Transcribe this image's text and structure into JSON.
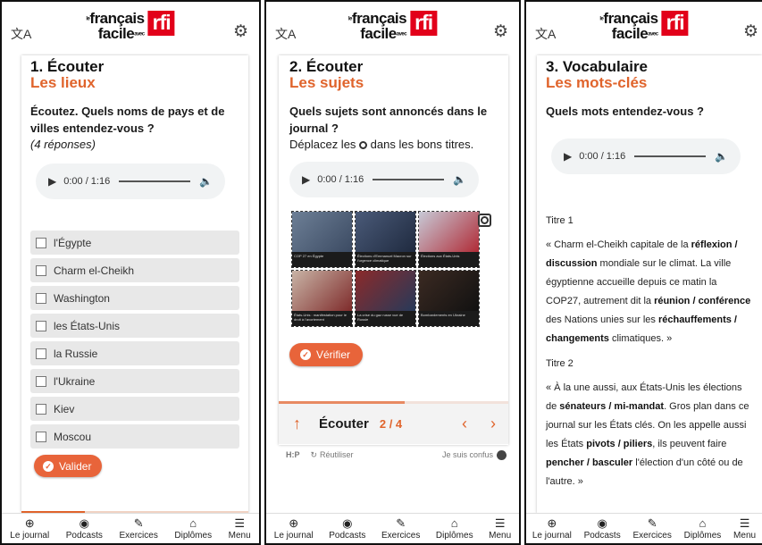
{
  "panels": [
    {
      "header": {
        "translate_icon": "translate-icon",
        "settings_icon": "gear-icon"
      },
      "section": "1. Écouter",
      "subtitle": "Les lieux",
      "question": "Écoutez. Quels noms de pays et de villes entendez-vous ?",
      "note": "(4 réponses)",
      "audio": {
        "time": "0:00 / 1:16"
      },
      "options": [
        "l'Égypte",
        "Charm el-Cheikh",
        "Washington",
        "les États-Unis",
        "la Russie",
        "l'Ukraine",
        "Kiev",
        "Moscou"
      ],
      "button": "Valider"
    },
    {
      "section": "2. Écouter",
      "subtitle": "Les sujets",
      "question": "Quels sujets sont annoncés dans le journal ?",
      "instruction_pre": "Déplacez les ",
      "instruction_post": " dans les bons titres.",
      "audio": {
        "time": "0:00 / 1:16"
      },
      "tiles": [
        {
          "caption": "COP 27 en Égypte",
          "colors": [
            "#6d7f96",
            "#3b4a62"
          ]
        },
        {
          "caption": "Élections d'Emmanuel Macron sur l'urgence climatique",
          "colors": [
            "#4a5a78",
            "#1f2a3f"
          ]
        },
        {
          "caption": "Élections aux États-Unis",
          "colors": [
            "#c7c9d6",
            "#b02a35"
          ]
        },
        {
          "caption": "États-Unis : manifestation pour le droit à l'avortement",
          "colors": [
            "#c9b4a6",
            "#7e2a2a"
          ]
        },
        {
          "caption": "La crise du gaz russe vue de Russie",
          "colors": [
            "#8b2a2a",
            "#263a5a"
          ]
        },
        {
          "caption": "Bombardements en Ukraine",
          "colors": [
            "#3b2a22",
            "#111111"
          ]
        }
      ],
      "button": "Vérifier",
      "progress": 0.55,
      "pager": {
        "label": "Écouter",
        "count": "2 / 4"
      },
      "footer": {
        "left": "H:P",
        "reuse": "Réutiliser",
        "confused": "Je suis confus"
      }
    },
    {
      "section": "3. Vocabulaire",
      "subtitle": "Les mots-clés",
      "question": "Quels mots entendez-vous ?",
      "audio": {
        "time": "0:00 / 1:16"
      },
      "titre1": "Titre 1",
      "t1_a": "« Charm el-Cheikh capitale de la ",
      "t1_b": "réflexion / discussion",
      "t1_c": " mondiale sur le climat. La ville égyptienne accueille depuis ce matin la COP27, autrement dit la ",
      "t1_d": "réunion / conférence",
      "t1_e": " des Nations unies sur les ",
      "t1_f": "réchauffements / changements",
      "t1_g": " climatiques. »",
      "titre2": "Titre 2",
      "t2_a": "« À la une aussi, aux États-Unis les élections de ",
      "t2_b": "sénateurs / mi-mandat",
      "t2_c": ". Gros plan dans ce journal sur les États clés. On les appelle aussi les États ",
      "t2_d": "pivots / piliers",
      "t2_e": ", ils peuvent faire ",
      "t2_f": "pencher / basculer",
      "t2_g": " l'élection d'un côté ou de l'autre. »"
    }
  ],
  "logo": {
    "line1": "français",
    "line1_small": "le",
    "line2": "facile",
    "line2_small": "avec",
    "brand": "rfi"
  },
  "nav": [
    {
      "label": "Le journal",
      "icon": "globe-icon"
    },
    {
      "label": "Podcasts",
      "icon": "podcast-icon"
    },
    {
      "label": "Exercices",
      "icon": "pencil-icon"
    },
    {
      "label": "Diplômes",
      "icon": "diploma-icon"
    },
    {
      "label": "Menu",
      "icon": "hamburger-icon"
    }
  ],
  "colors": {
    "accent": "#e0642c",
    "brand_red": "#e2001a"
  }
}
